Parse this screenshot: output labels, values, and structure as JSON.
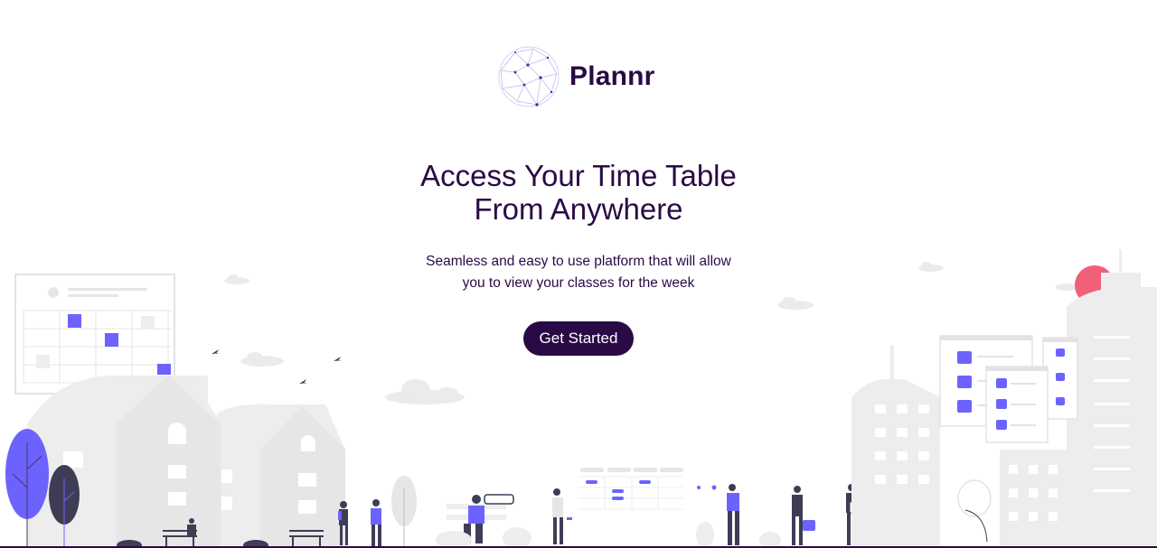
{
  "brand": {
    "name": "Plannr",
    "logo_icon": "wireframe-globe-icon"
  },
  "hero": {
    "title_line1": "Access Your Time Table",
    "title_line2": "From Anywhere",
    "subtitle_line1": "Seamless and easy to use platform that will allow",
    "subtitle_line2": "you to view your classes for the week",
    "cta_label": "Get Started"
  },
  "colors": {
    "primary": "#2a0a45",
    "accent": "#6c63ff",
    "sun": "#f25f7a",
    "building_gray": "#ededed",
    "outline_gray": "#e3e3e3"
  },
  "illustration": {
    "name": "city-people-illustration"
  }
}
